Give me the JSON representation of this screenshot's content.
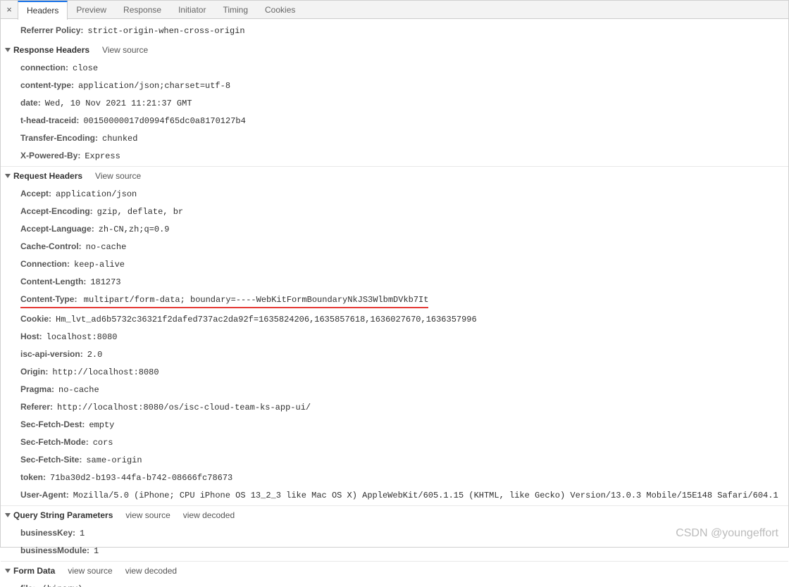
{
  "tabs": [
    "Headers",
    "Preview",
    "Response",
    "Initiator",
    "Timing",
    "Cookies"
  ],
  "activeTab": 0,
  "referrerPolicy": {
    "label": "Referrer Policy",
    "value": "strict-origin-when-cross-origin"
  },
  "sections": {
    "response": {
      "title": "Response Headers",
      "viewSource": "View source",
      "headers": [
        {
          "k": "connection",
          "v": "close"
        },
        {
          "k": "content-type",
          "v": "application/json;charset=utf-8"
        },
        {
          "k": "date",
          "v": "Wed, 10 Nov 2021 11:21:37 GMT"
        },
        {
          "k": "t-head-traceid",
          "v": "00150000017d0994f65dc0a8170127b4"
        },
        {
          "k": "Transfer-Encoding",
          "v": "chunked"
        },
        {
          "k": "X-Powered-By",
          "v": "Express"
        }
      ]
    },
    "request": {
      "title": "Request Headers",
      "viewSource": "View source",
      "headers": [
        {
          "k": "Accept",
          "v": "application/json"
        },
        {
          "k": "Accept-Encoding",
          "v": "gzip, deflate, br"
        },
        {
          "k": "Accept-Language",
          "v": "zh-CN,zh;q=0.9"
        },
        {
          "k": "Cache-Control",
          "v": "no-cache"
        },
        {
          "k": "Connection",
          "v": "keep-alive"
        },
        {
          "k": "Content-Length",
          "v": "181273"
        },
        {
          "k": "Content-Type",
          "v": "multipart/form-data; boundary=----WebKitFormBoundaryNkJS3WlbmDVkb7It",
          "hl": true
        },
        {
          "k": "Cookie",
          "v": "Hm_lvt_ad6b5732c36321f2dafed737ac2da92f=1635824206,1635857618,1636027670,1636357996"
        },
        {
          "k": "Host",
          "v": "localhost:8080"
        },
        {
          "k": "isc-api-version",
          "v": "2.0"
        },
        {
          "k": "Origin",
          "v": "http://localhost:8080"
        },
        {
          "k": "Pragma",
          "v": "no-cache"
        },
        {
          "k": "Referer",
          "v": "http://localhost:8080/os/isc-cloud-team-ks-app-ui/"
        },
        {
          "k": "Sec-Fetch-Dest",
          "v": "empty"
        },
        {
          "k": "Sec-Fetch-Mode",
          "v": "cors"
        },
        {
          "k": "Sec-Fetch-Site",
          "v": "same-origin"
        },
        {
          "k": "token",
          "v": "71ba30d2-b193-44fa-b742-08666fc78673"
        },
        {
          "k": "User-Agent",
          "v": "Mozilla/5.0 (iPhone; CPU iPhone OS 13_2_3 like Mac OS X) AppleWebKit/605.1.15 (KHTML, like Gecko) Version/13.0.3 Mobile/15E148 Safari/604.1"
        }
      ]
    },
    "query": {
      "title": "Query String Parameters",
      "viewSource": "view source",
      "viewDecoded": "view decoded",
      "headers": [
        {
          "k": "businessKey",
          "v": "1"
        },
        {
          "k": "businessModule",
          "v": "1"
        }
      ]
    },
    "form": {
      "title": "Form Data",
      "viewSource": "view source",
      "viewDecoded": "view decoded",
      "headers": [
        {
          "k": "file",
          "v": "(binary)",
          "hl": true
        }
      ]
    }
  },
  "watermark": "CSDN @youngeffort"
}
